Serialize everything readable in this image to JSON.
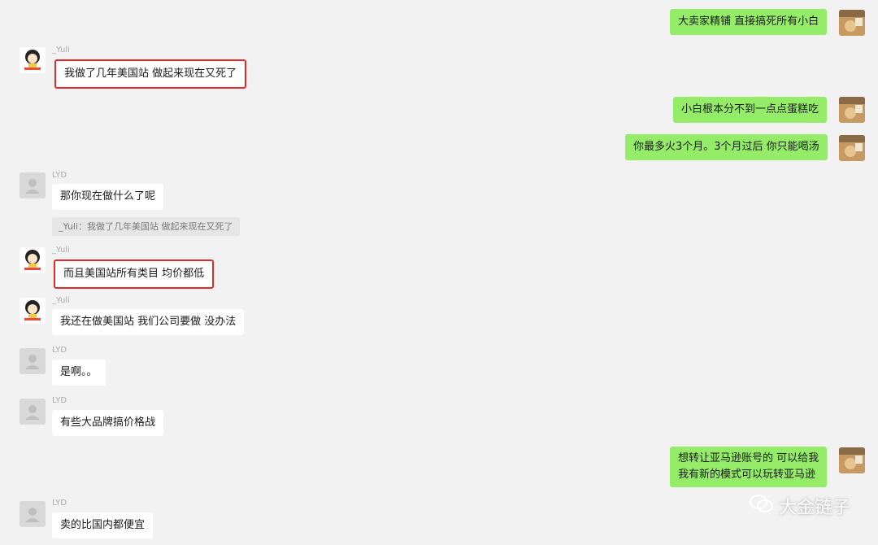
{
  "messages": [
    {
      "side": "right",
      "text": "大卖家精铺 直接搞死所有小白"
    },
    {
      "side": "left",
      "name": "_Yuli",
      "text": "我做了几年美国站 做起来现在又死了",
      "highlight": true
    },
    {
      "side": "right",
      "text": "小白根本分不到一点点蛋糕吃"
    },
    {
      "side": "right",
      "text": "你最多火3个月。3个月过后 你只能喝汤"
    },
    {
      "side": "left",
      "name": "LYD",
      "text": "那你现在做什么了呢"
    },
    {
      "side": "left",
      "name": "_Yuli",
      "text": "而且美国站所有类目 均价都低",
      "highlight": true
    },
    {
      "side": "left",
      "name": "_Yuli",
      "text": "我还在做美国站 我们公司要做 没办法"
    },
    {
      "side": "left",
      "name": "LYD",
      "text": "是啊。。"
    },
    {
      "side": "left",
      "name": "LYD",
      "text": "有些大品牌搞价格战"
    },
    {
      "side": "right",
      "lines": [
        "想转让亚马逊账号的 可以给我",
        "我有新的模式可以玩转亚马逊"
      ]
    },
    {
      "side": "left",
      "name": "LYD",
      "text": "卖的比国内都便宜"
    }
  ],
  "quote": "_Yuli：我做了几年美国站 做起来现在又死了",
  "watermark": "大金链子"
}
